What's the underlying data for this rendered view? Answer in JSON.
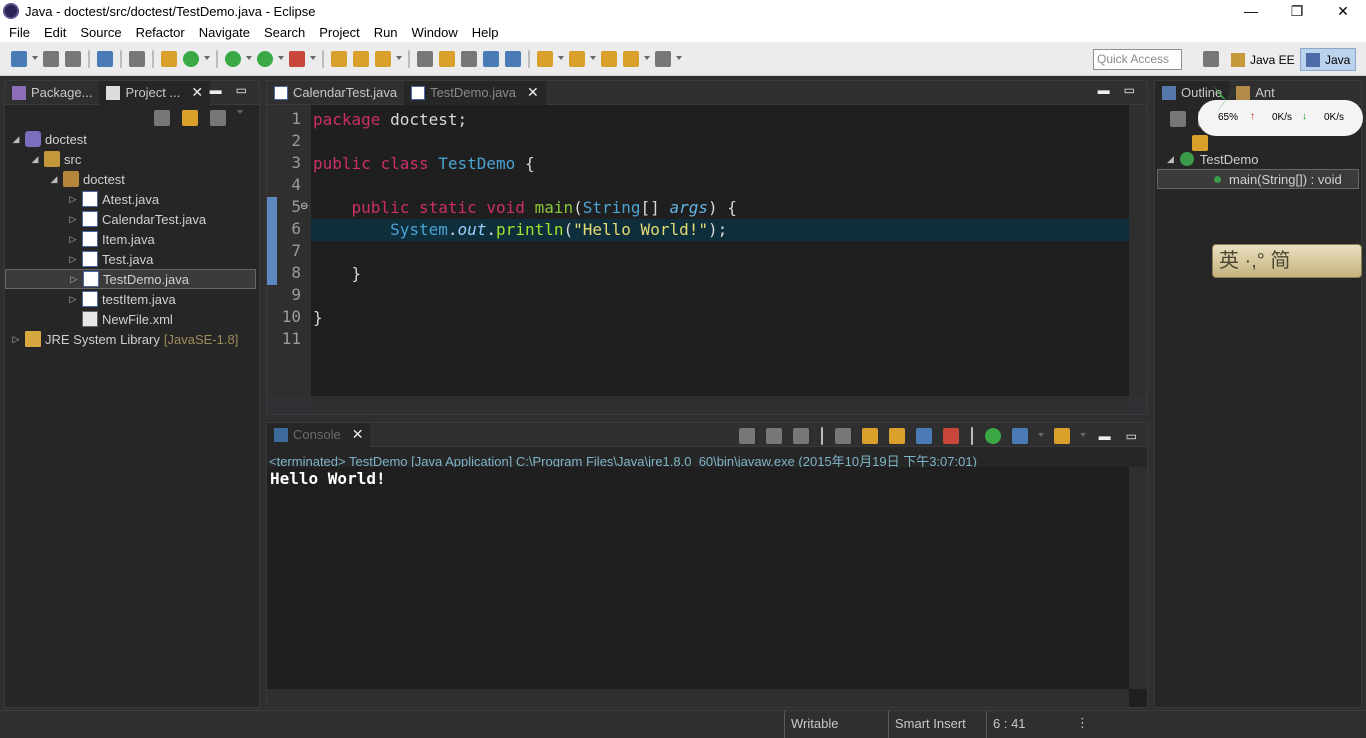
{
  "window": {
    "title": "Java - doctest/src/doctest/TestDemo.java - Eclipse",
    "min": "—",
    "max": "❐",
    "close": "✕"
  },
  "menu": [
    "File",
    "Edit",
    "Source",
    "Refactor",
    "Navigate",
    "Search",
    "Project",
    "Run",
    "Window",
    "Help"
  ],
  "toolbar": {
    "quick_access_placeholder": "Quick Access",
    "perspectives": [
      {
        "label": "Java EE",
        "active": false
      },
      {
        "label": "Java",
        "active": true
      }
    ]
  },
  "left_panel": {
    "tabs": [
      {
        "label": "Package...",
        "active": false
      },
      {
        "label": "Project ...",
        "active": true,
        "close": "✕"
      }
    ],
    "tree": [
      {
        "label": "doctest",
        "arrow": "◢",
        "icon": "project-icon",
        "depth": 0
      },
      {
        "label": "src",
        "arrow": "◢",
        "icon": "source-folder-icon",
        "depth": 1
      },
      {
        "label": "doctest",
        "arrow": "◢",
        "icon": "package-icon",
        "depth": 2
      },
      {
        "label": "Atest.java",
        "arrow": "▷",
        "icon": "java-file-icon",
        "depth": 3
      },
      {
        "label": "CalendarTest.java",
        "arrow": "▷",
        "icon": "java-file-icon",
        "depth": 3
      },
      {
        "label": "Item.java",
        "arrow": "▷",
        "icon": "java-file-icon",
        "depth": 3
      },
      {
        "label": "Test.java",
        "arrow": "▷",
        "icon": "java-file-icon",
        "depth": 3
      },
      {
        "label": "TestDemo.java",
        "arrow": "▷",
        "icon": "java-file-icon",
        "depth": 3,
        "selected": true
      },
      {
        "label": "testItem.java",
        "arrow": "▷",
        "icon": "java-file-icon",
        "depth": 3
      },
      {
        "label": "NewFile.xml",
        "arrow": "",
        "icon": "xml-file-icon",
        "depth": 3
      },
      {
        "label": "JRE System Library",
        "arrow": "▷",
        "icon": "library-icon",
        "depth": 0,
        "tag": "[JavaSE-1.8]"
      }
    ]
  },
  "editor": {
    "tabs": [
      {
        "label": "CalendarTest.java",
        "active": false
      },
      {
        "label": "TestDemo.java",
        "active": true,
        "close": "✕"
      }
    ],
    "line_numbers": [
      "1",
      "2",
      "3",
      "4",
      "5",
      "6",
      "7",
      "8",
      "9",
      "10",
      "11"
    ],
    "fold_marker": "⊖",
    "code": {
      "l1_kw": "package",
      "l1_rest": " doctest;",
      "l3_kw1": "public",
      "l3_kw2": "class",
      "l3_name": "TestDemo",
      "l3_rest": " {",
      "l5_kw1": "public",
      "l5_kw2": "static",
      "l5_kw3": "void",
      "l5_fn": "main",
      "l5_p1": "(",
      "l5_ty": "String",
      "l5_p2": "[] ",
      "l5_arg": "args",
      "l5_p3": ") {",
      "l6_cls": "System",
      "l6_dot1": ".",
      "l6_fld": "out",
      "l6_dot2": ".",
      "l6_mth": "println",
      "l6_p1": "(",
      "l6_str": "\"Hello World!\"",
      "l6_p2": ");",
      "l8": "}",
      "l10": "}"
    }
  },
  "console": {
    "tab": {
      "label": "Console",
      "close": "✕"
    },
    "terminated": "<terminated> TestDemo [Java Application] C:\\Program Files\\Java\\jre1.8.0_60\\bin\\javaw.exe (2015年10月19日 下午3:07:01)",
    "output": "Hello World!"
  },
  "outline": {
    "tabs": [
      {
        "label": "Outline",
        "active": true
      },
      {
        "label": "Ant",
        "active": false
      }
    ],
    "items": [
      {
        "label": "TestDemo",
        "icon": "class-icon"
      },
      {
        "label": "main(String[]) : void",
        "icon": "method-icon",
        "selected": true
      }
    ]
  },
  "net_widget": {
    "percent": "65%",
    "up": "0K/s",
    "down": "0K/s",
    "up_arrow": "↑",
    "down_arrow": "↓"
  },
  "ime_badge": {
    "text": "英 ·,° 简"
  },
  "status": {
    "writable": "Writable",
    "insert_mode": "Smart Insert",
    "position": "6 : 41",
    "menu_dots": "⋮"
  }
}
